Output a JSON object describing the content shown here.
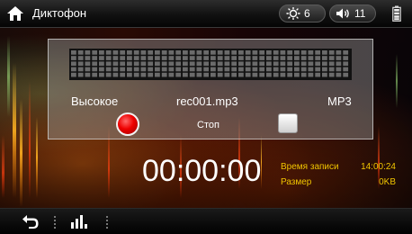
{
  "header": {
    "title": "Диктофон",
    "brightness_value": "6",
    "volume_value": "11"
  },
  "recorder": {
    "quality": "Высокое",
    "filename": "rec001.mp3",
    "format": "MP3",
    "stop_label": "Стоп",
    "meter_level": 0.0
  },
  "timer": "00:00:00",
  "info": {
    "record_time_label": "Время записи",
    "record_time_value": "14:00:24",
    "size_label": "Размер",
    "size_value": "0KB"
  },
  "colors": {
    "accent_yellow": "#f0c400",
    "record_red": "#e00000"
  }
}
